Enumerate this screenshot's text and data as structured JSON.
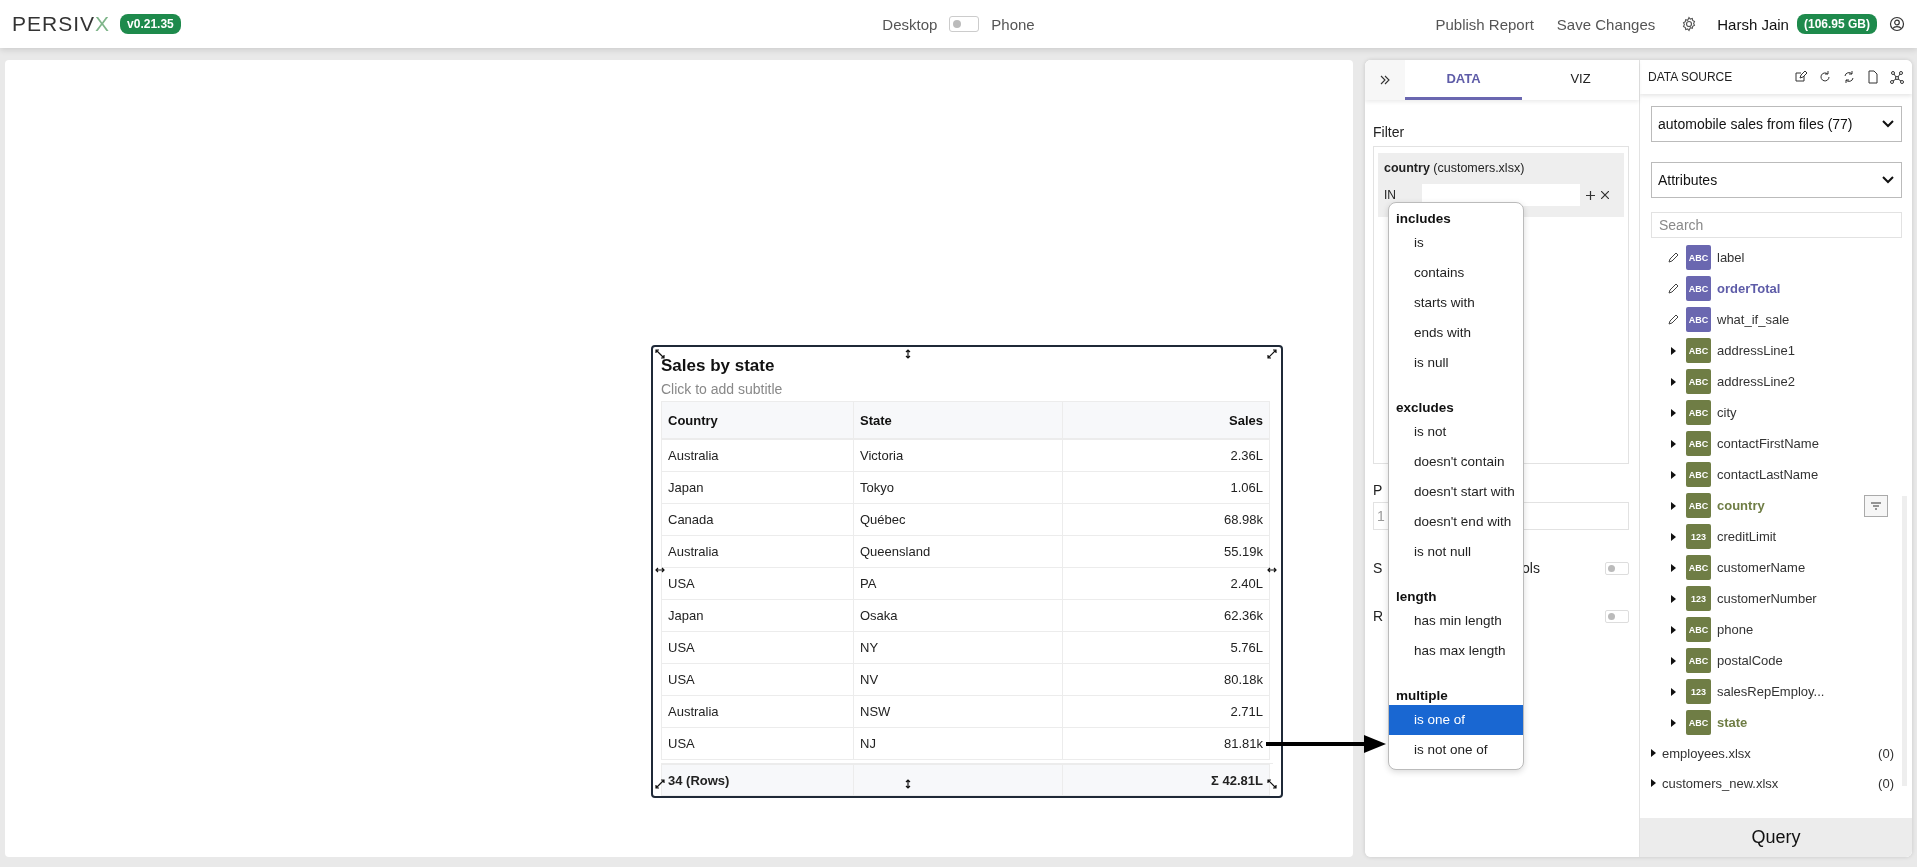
{
  "header": {
    "logo_main": "PERSIV",
    "logo_mark": "X",
    "version": "v0.21.35",
    "view_left": "Desktop",
    "view_right": "Phone",
    "view_toggle_on": false,
    "actions": [
      "Publish Report",
      "Save Changes"
    ],
    "user": "Harsh Jain",
    "storage": "(106.95 GB)"
  },
  "widget": {
    "title": "Sales by state",
    "subtitle": "Click to add subtitle",
    "columns": [
      "Country",
      "State",
      "Sales"
    ],
    "rows": [
      [
        "Australia",
        "Victoria",
        "2.36L"
      ],
      [
        "Japan",
        "Tokyo",
        "1.06L"
      ],
      [
        "Canada",
        "Québec",
        "68.98k"
      ],
      [
        "Australia",
        "Queensland",
        "55.19k"
      ],
      [
        "USA",
        "PA",
        "2.40L"
      ],
      [
        "Japan",
        "Osaka",
        "62.36k"
      ],
      [
        "USA",
        "NY",
        "5.76L"
      ],
      [
        "USA",
        "NV",
        "80.18k"
      ],
      [
        "Australia",
        "NSW",
        "2.71L"
      ],
      [
        "USA",
        "NJ",
        "81.81k"
      ]
    ],
    "footer": {
      "count": "34 (Rows)",
      "total": "Σ 42.81L"
    }
  },
  "panel": {
    "tabs": [
      {
        "label": "DATA",
        "selected": true
      },
      {
        "label": "VIZ",
        "selected": false
      }
    ],
    "filter_label": "Filter",
    "filter": {
      "field": "country",
      "source": "(customers.xlsx)",
      "operator": "IN"
    },
    "settings": [
      {
        "kind": "field",
        "label": "P",
        "value": "1"
      },
      {
        "kind": "toggle",
        "label": "S",
        "label_end": "ols",
        "on": false
      },
      {
        "kind": "toggle",
        "label": "R",
        "on": false
      }
    ],
    "operators": [
      {
        "heading": "includes",
        "options": [
          {
            "label": "is",
            "selected": false
          },
          {
            "label": "contains",
            "selected": false
          },
          {
            "label": "starts with",
            "selected": false
          },
          {
            "label": "ends with",
            "selected": false
          },
          {
            "label": "is null",
            "selected": false
          }
        ]
      },
      {
        "heading": "excludes",
        "options": [
          {
            "label": "is not",
            "selected": false
          },
          {
            "label": "doesn't contain",
            "selected": false
          },
          {
            "label": "doesn't start with",
            "selected": false
          },
          {
            "label": "doesn't end with",
            "selected": false
          },
          {
            "label": "is not null",
            "selected": false
          }
        ]
      },
      {
        "heading": "length",
        "options": [
          {
            "label": "has min length",
            "selected": false
          },
          {
            "label": "has max length",
            "selected": false
          }
        ]
      },
      {
        "heading": "multiple",
        "options": [
          {
            "label": "is one of",
            "selected": true
          },
          {
            "label": "is not one of",
            "selected": false
          }
        ]
      }
    ]
  },
  "data_source": {
    "title": "DATA SOURCE",
    "source": "automobile sales from files (77)",
    "view": "Attributes",
    "search_placeholder": "Search",
    "attributes": [
      {
        "kind": "calculated",
        "type": "ABC",
        "name": "label",
        "in_use": false,
        "filtered": false
      },
      {
        "kind": "calculated",
        "type": "ABC",
        "name": "orderTotal",
        "in_use": true,
        "filtered": false
      },
      {
        "kind": "calculated",
        "type": "ABC",
        "name": "what_if_sale",
        "in_use": false,
        "filtered": false
      },
      {
        "kind": "field",
        "type": "ABC",
        "name": "addressLine1",
        "in_use": false,
        "filtered": false
      },
      {
        "kind": "field",
        "type": "ABC",
        "name": "addressLine2",
        "in_use": false,
        "filtered": false
      },
      {
        "kind": "field",
        "type": "ABC",
        "name": "city",
        "in_use": false,
        "filtered": false
      },
      {
        "kind": "field",
        "type": "ABC",
        "name": "contactFirstName",
        "in_use": false,
        "filtered": false
      },
      {
        "kind": "field",
        "type": "ABC",
        "name": "contactLastName",
        "in_use": false,
        "filtered": false
      },
      {
        "kind": "field",
        "type": "ABC",
        "name": "country",
        "in_use": true,
        "filtered": true
      },
      {
        "kind": "field",
        "type": "123",
        "name": "creditLimit",
        "in_use": false,
        "filtered": false
      },
      {
        "kind": "field",
        "type": "ABC",
        "name": "customerName",
        "in_use": false,
        "filtered": false
      },
      {
        "kind": "field",
        "type": "123",
        "name": "customerNumber",
        "in_use": false,
        "filtered": false
      },
      {
        "kind": "field",
        "type": "ABC",
        "name": "phone",
        "in_use": false,
        "filtered": false
      },
      {
        "kind": "field",
        "type": "ABC",
        "name": "postalCode",
        "in_use": false,
        "filtered": false
      },
      {
        "kind": "field",
        "type": "123",
        "name": "salesRepEmploy...",
        "in_use": false,
        "filtered": false
      },
      {
        "kind": "field",
        "type": "ABC",
        "name": "state",
        "in_use": true,
        "filtered": false
      }
    ],
    "files": [
      {
        "name": "employees.xlsx",
        "count": "(0)"
      },
      {
        "name": "customers_new.xlsx",
        "count": "(0)"
      }
    ],
    "query_button": "Query"
  }
}
